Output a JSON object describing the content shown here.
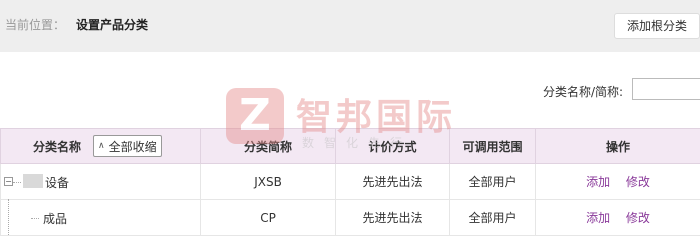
{
  "breadcrumb": {
    "prefix": "当前位置：",
    "current": "设置产品分类"
  },
  "toolbar": {
    "add_root_label": "添加根分类"
  },
  "search": {
    "label": "分类名称/简称:",
    "value": ""
  },
  "table": {
    "headers": {
      "name": "分类名称",
      "collapse_all": "全部收缩",
      "short_name": "分类简称",
      "pricing": "计价方式",
      "scope": "可调用范围",
      "actions": "操作"
    },
    "rows": [
      {
        "name": "设备",
        "short_name": "JXSB",
        "pricing": "先进先出法",
        "scope": "全部用户",
        "add": "添加",
        "edit": "修改"
      },
      {
        "name": "成品",
        "short_name": "CP",
        "pricing": "先进先出法",
        "scope": "全部用户",
        "add": "添加",
        "edit": "修改"
      }
    ]
  },
  "watermark": {
    "logo_letter": "Z",
    "title": "智邦国际",
    "subtitle": "数智化先行"
  },
  "colors": {
    "header_bg": "#f3e8f3",
    "link": "#8a3a9a",
    "topbar_bg": "#eeeeee"
  }
}
